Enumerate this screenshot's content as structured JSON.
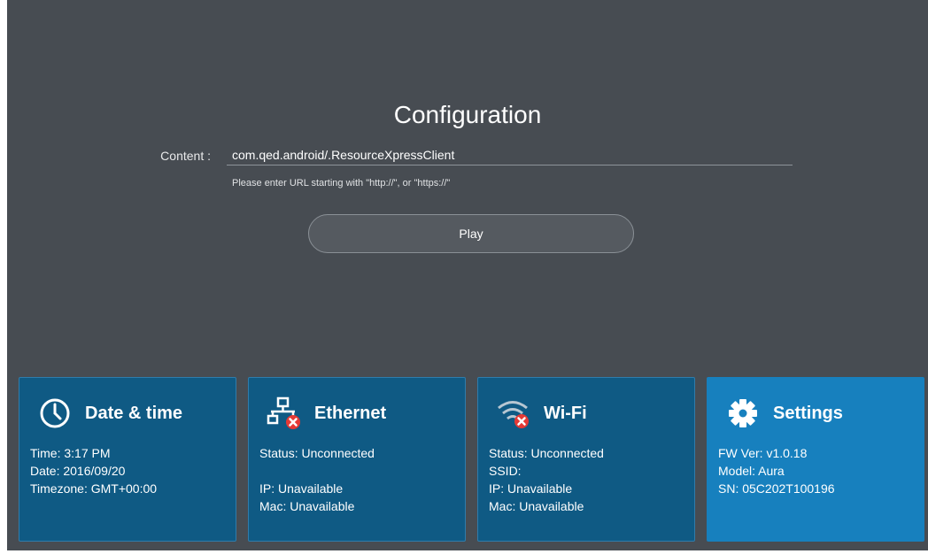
{
  "config": {
    "title": "Configuration",
    "content_label": "Content :",
    "content_value": "com.qed.android/.ResourceXpressClient",
    "hint": "Please enter URL starting with \"http://\", or \"https://\"",
    "play_label": "Play"
  },
  "cards": {
    "datetime": {
      "title": "Date & time",
      "icon": "clock-icon",
      "time": "Time: 3:17 PM",
      "date": "Date: 2016/09/20",
      "timezone": "Timezone: GMT+00:00"
    },
    "ethernet": {
      "title": "Ethernet",
      "icon": "ethernet-disconnected-icon",
      "status": "Status: Unconnected",
      "ip": "IP: Unavailable",
      "mac": "Mac: Unavailable"
    },
    "wifi": {
      "title": "Wi-Fi",
      "icon": "wifi-disconnected-icon",
      "status": "Status: Unconnected",
      "ssid": "SSID:",
      "ip": "IP: Unavailable",
      "mac": "Mac: Unavailable"
    },
    "settings": {
      "title": "Settings",
      "icon": "gear-icon",
      "fw": "FW Ver: v1.0.18",
      "model": "Model: Aura",
      "sn": "SN: 05C202T100196"
    }
  },
  "colors": {
    "background": "#474c52",
    "card": "#0f5a84",
    "card_active": "#1780be",
    "error": "#e53935"
  }
}
